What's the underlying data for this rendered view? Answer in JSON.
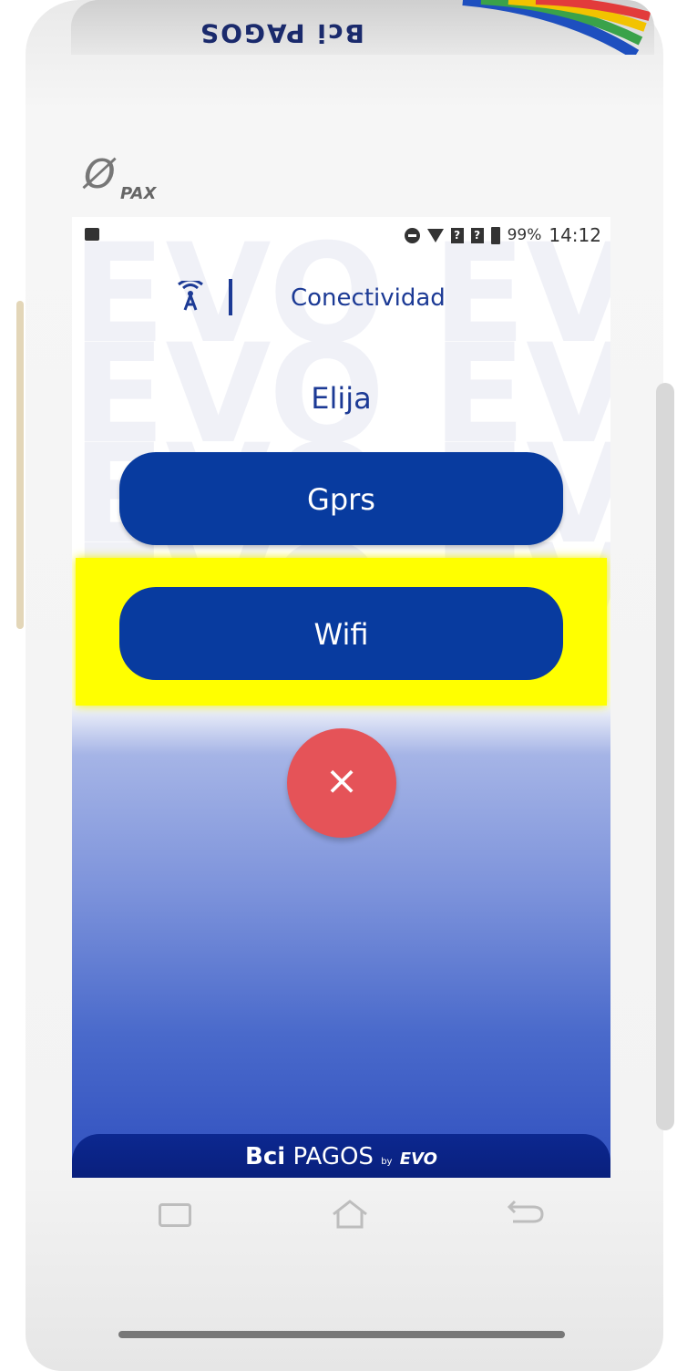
{
  "device": {
    "brand_top": "Bci PAGOS",
    "maker_logo": "PAX"
  },
  "statusbar": {
    "battery_percent": "99%",
    "time": "14:12",
    "icons": [
      "image-icon",
      "do-not-disturb-icon",
      "wifi-icon",
      "sim1-icon",
      "sim2-icon",
      "battery-icon"
    ]
  },
  "header": {
    "icon": "antenna-icon",
    "title": "Conectividad"
  },
  "prompt": "Elija",
  "options": {
    "gprs_label": "Gprs",
    "wifi_label": "Wifi"
  },
  "close_glyph": "×",
  "footer": {
    "brand_bold": "Bci",
    "brand_rest": " PAGOS ",
    "by": "by",
    "partner": "EVO"
  },
  "colors": {
    "primary": "#083b9f",
    "title_blue": "#1c3a95",
    "close": "#e55358",
    "highlight": "#ffff00"
  }
}
